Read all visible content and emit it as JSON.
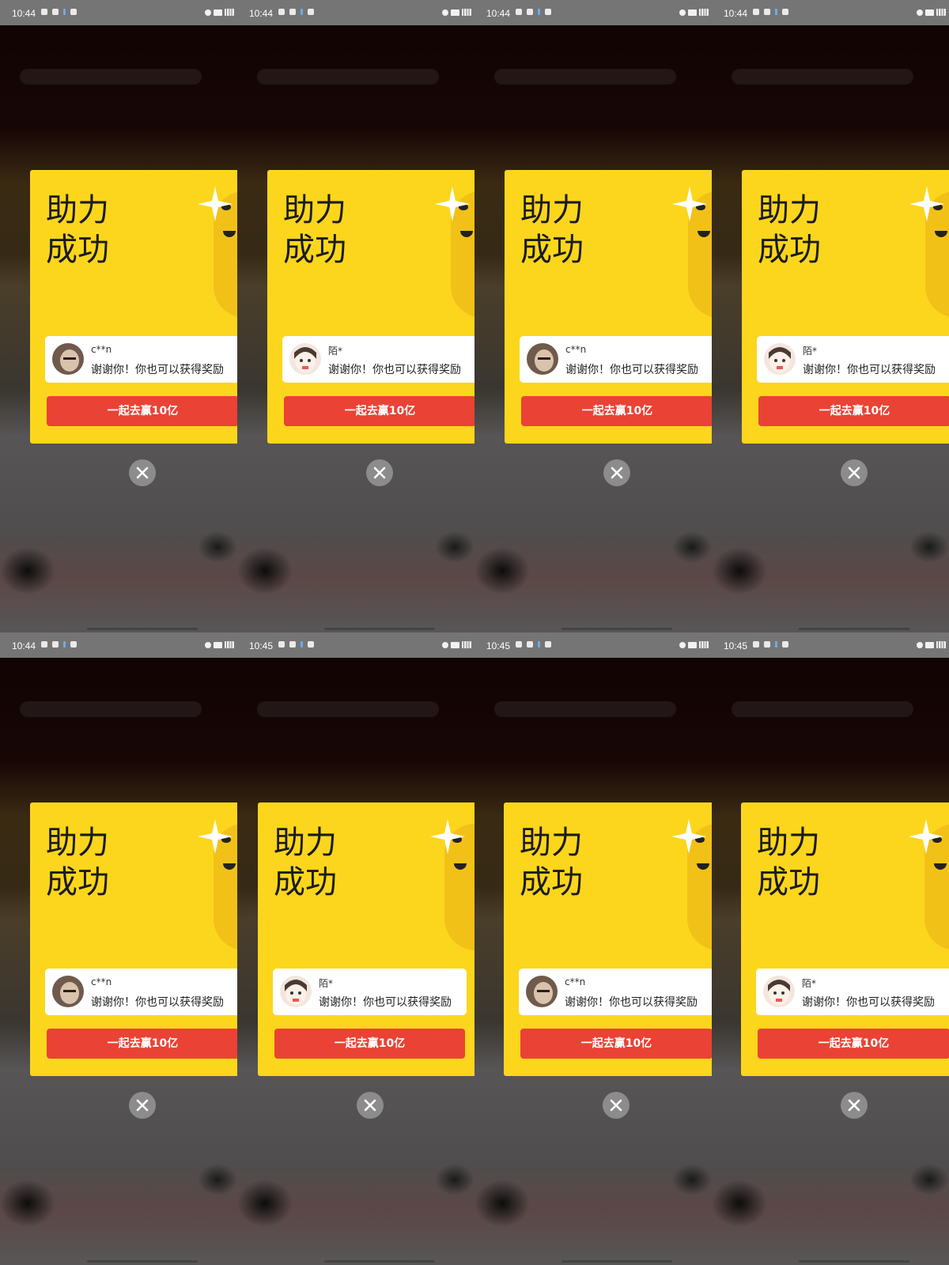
{
  "panels": [
    {
      "time": "10:44",
      "username": "c**n",
      "avatar": "face-c",
      "title_line1": "助力",
      "title_line2": "成功",
      "message": "谢谢你！你也可以获得奖励",
      "button": "一起去赢10亿"
    },
    {
      "time": "10:44",
      "username": "陌*",
      "avatar": "face-mo",
      "title_line1": "助力",
      "title_line2": "成功",
      "message": "谢谢你！你也可以获得奖励",
      "button": "一起去赢10亿"
    },
    {
      "time": "10:44",
      "username": "c**n",
      "avatar": "face-c",
      "title_line1": "助力",
      "title_line2": "成功",
      "message": "谢谢你！你也可以获得奖励",
      "button": "一起去赢10亿"
    },
    {
      "time": "10:44",
      "username": "陌*",
      "avatar": "face-mo",
      "title_line1": "助力",
      "title_line2": "成功",
      "message": "谢谢你！你也可以获得奖励",
      "button": "一起去赢10亿"
    },
    {
      "time": "10:44",
      "username": "c**n",
      "avatar": "face-c",
      "title_line1": "助力",
      "title_line2": "成功",
      "message": "谢谢你！你也可以获得奖励",
      "button": "一起去赢10亿"
    },
    {
      "time": "10:45",
      "username": "陌*",
      "avatar": "face-mo",
      "title_line1": "助力",
      "title_line2": "成功",
      "message": "谢谢你！你也可以获得奖励",
      "button": "一起去赢10亿"
    },
    {
      "time": "10:45",
      "username": "c**n",
      "avatar": "face-c",
      "title_line1": "助力",
      "title_line2": "成功",
      "message": "谢谢你！你也可以获得奖励",
      "button": "一起去赢10亿"
    },
    {
      "time": "10:45",
      "username": "陌*",
      "avatar": "face-mo",
      "title_line1": "助力",
      "title_line2": "成功",
      "message": "谢谢你！你也可以获得奖励",
      "button": "一起去赢10亿"
    }
  ],
  "colors": {
    "card": "#fcd61c",
    "button": "#ea4235",
    "statusbar": "#757575",
    "close": "#8c8c8c"
  },
  "icons": [
    "close-icon",
    "star-sparkle-icon",
    "alarm-icon",
    "signal-icon",
    "wechat-icon",
    "notification-icon"
  ]
}
